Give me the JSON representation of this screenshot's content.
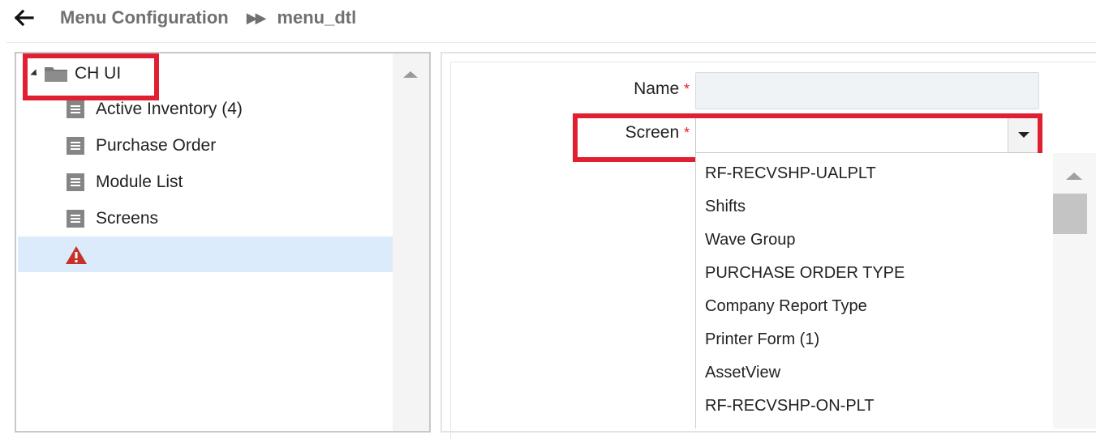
{
  "breadcrumb": {
    "items": [
      "Menu Configuration",
      "menu_dtl"
    ],
    "separator": "▶▶"
  },
  "tree": {
    "root": {
      "label": "CH UI",
      "expanded": true
    },
    "items": [
      {
        "label": "Active Inventory (4)"
      },
      {
        "label": "Purchase Order"
      },
      {
        "label": "Module List"
      },
      {
        "label": "Screens"
      }
    ],
    "selected_item": {
      "label": "",
      "icon": "warning-icon"
    }
  },
  "form": {
    "name": {
      "label": "Name",
      "required_mark": "*",
      "value": ""
    },
    "screen": {
      "label": "Screen",
      "required_mark": "*",
      "value": ""
    }
  },
  "dropdown": {
    "options": [
      "RF-RECVSHP-UALPLT",
      "Shifts",
      "Wave Group",
      "PURCHASE ORDER TYPE",
      "Company Report Type",
      "Printer Form (1)",
      "AssetView",
      "RF-RECVSHP-ON-PLT"
    ]
  },
  "colors": {
    "highlight_border": "#e02030",
    "selected_row": "#dcebfb",
    "icon_gray": "#858585",
    "warning": "#c8302a"
  },
  "icons": [
    "back-arrow-icon",
    "folder-icon",
    "document-icon",
    "warning-icon",
    "chevron-down-icon",
    "scroll-up-icon"
  ]
}
